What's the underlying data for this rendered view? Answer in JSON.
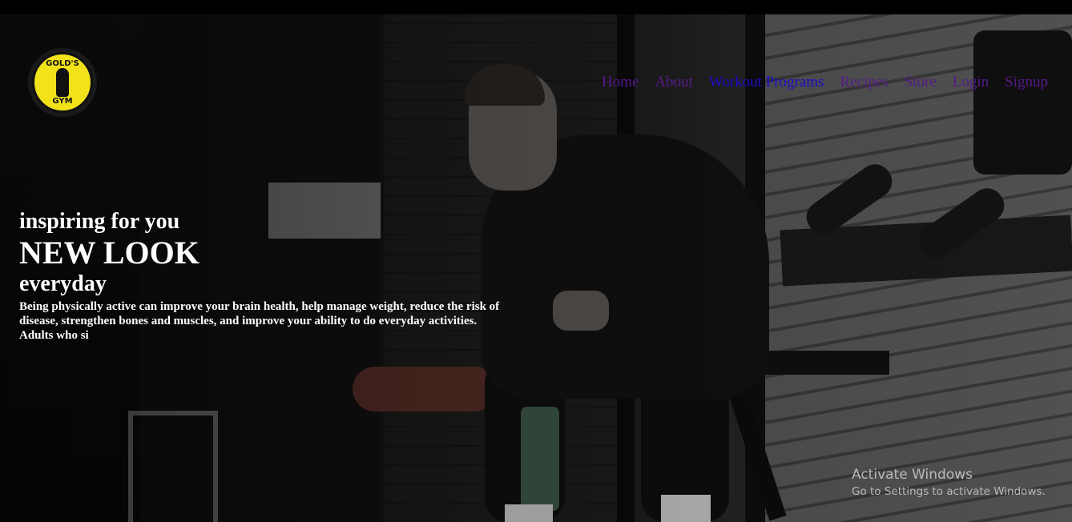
{
  "logo": {
    "top_text": "GOLD'S",
    "bottom_text": "GYM"
  },
  "nav": {
    "items": [
      "Home",
      "About",
      "Workout Programs",
      "Recipes",
      "Store",
      "Login",
      "Signup"
    ],
    "visited_color": "#551a8b",
    "active_color": "#1a0dcc"
  },
  "hero": {
    "line1": "inspiring for you",
    "line2": "NEW LOOK",
    "line3": "everyday",
    "description": "Being physically active can improve your brain health, help manage weight, reduce the risk of disease, strengthen bones and muscles, and improve your ability to do everyday activities. Adults who si"
  },
  "watermark": {
    "title": "Activate Windows",
    "subtitle": "Go to Settings to activate Windows."
  },
  "colors": {
    "logo_yellow": "#f2e21a",
    "text": "#ffffff"
  }
}
